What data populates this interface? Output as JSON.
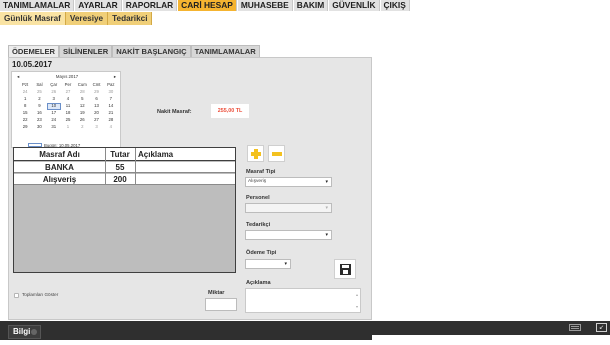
{
  "top_menu": {
    "items": [
      {
        "label": "TANIMLAMALAR"
      },
      {
        "label": "AYARLAR"
      },
      {
        "label": "RAPORLAR"
      },
      {
        "label": "CARİ HESAP",
        "active": true
      },
      {
        "label": "MUHASEBE"
      },
      {
        "label": "BAKIM"
      },
      {
        "label": "GÜVENLİK"
      },
      {
        "label": "ÇIKIŞ"
      }
    ]
  },
  "sub_menu": {
    "items": [
      {
        "label": "Günlük Masraf",
        "active": true
      },
      {
        "label": "Veresiye"
      },
      {
        "label": "Tedarikci"
      }
    ]
  },
  "tabs": [
    {
      "label": "ÖDEMELER",
      "active": true
    },
    {
      "label": "SİLİNENLER"
    },
    {
      "label": "NAKİT BAŞLANGIÇ"
    },
    {
      "label": "TANIMLAMALAR"
    }
  ],
  "date_label": "10.05.2017",
  "calendar": {
    "month_label": "Mayıs 2017",
    "prev": "◂",
    "next": "▸",
    "weekdays": [
      "Pzt",
      "Sal",
      "Çar",
      "Per",
      "Cum",
      "Cmt",
      "Paz"
    ],
    "days": [
      {
        "d": "24",
        "dim": true
      },
      {
        "d": "25",
        "dim": true
      },
      {
        "d": "26",
        "dim": true
      },
      {
        "d": "27",
        "dim": true
      },
      {
        "d": "28",
        "dim": true
      },
      {
        "d": "29",
        "dim": true
      },
      {
        "d": "30",
        "dim": true
      },
      {
        "d": "1"
      },
      {
        "d": "2"
      },
      {
        "d": "3"
      },
      {
        "d": "4"
      },
      {
        "d": "5"
      },
      {
        "d": "6"
      },
      {
        "d": "7"
      },
      {
        "d": "8"
      },
      {
        "d": "9"
      },
      {
        "d": "10",
        "today": true
      },
      {
        "d": "11"
      },
      {
        "d": "12"
      },
      {
        "d": "13"
      },
      {
        "d": "14"
      },
      {
        "d": "15"
      },
      {
        "d": "16"
      },
      {
        "d": "17"
      },
      {
        "d": "18"
      },
      {
        "d": "19"
      },
      {
        "d": "20"
      },
      {
        "d": "21"
      },
      {
        "d": "22"
      },
      {
        "d": "23"
      },
      {
        "d": "24"
      },
      {
        "d": "25"
      },
      {
        "d": "26"
      },
      {
        "d": "27"
      },
      {
        "d": "28"
      },
      {
        "d": "29"
      },
      {
        "d": "30"
      },
      {
        "d": "31"
      },
      {
        "d": "1",
        "dim": true
      },
      {
        "d": "2",
        "dim": true
      },
      {
        "d": "3",
        "dim": true
      },
      {
        "d": "4",
        "dim": true
      }
    ],
    "today_text": "Bugün: 10.05.2017"
  },
  "cash": {
    "label": "Nakit Masraf:",
    "value": "255,00 TL"
  },
  "table": {
    "headers": [
      "Masraf Adı",
      "Tutar",
      "Açıklama"
    ],
    "rows": [
      {
        "name": "BANKA",
        "amount": "55",
        "note": ""
      },
      {
        "name": "Alışveriş",
        "amount": "200",
        "note": ""
      }
    ]
  },
  "form": {
    "masraf_tipi_label": "Masraf Tipi",
    "masraf_tipi_value": "Alışveriş",
    "personel_label": "Personel",
    "tedarikci_label": "Tedarikçi",
    "odeme_tipi_label": "Ödeme Tipi",
    "aciklama_label": "Açıklama",
    "miktar_label": "Miktar",
    "show_totals_label": "Toplamları Göster"
  },
  "bottom": {
    "info_label": "Bilgi"
  },
  "colors": {
    "accent": "#f5b430",
    "submenu": "#f0cf78",
    "cash_value": "#ec4e3a",
    "plus_minus": "#f3c11f"
  },
  "icons": [
    "plus-icon",
    "minus-icon",
    "save-icon",
    "keyboard-icon",
    "expand-icon",
    "help-icon"
  ]
}
